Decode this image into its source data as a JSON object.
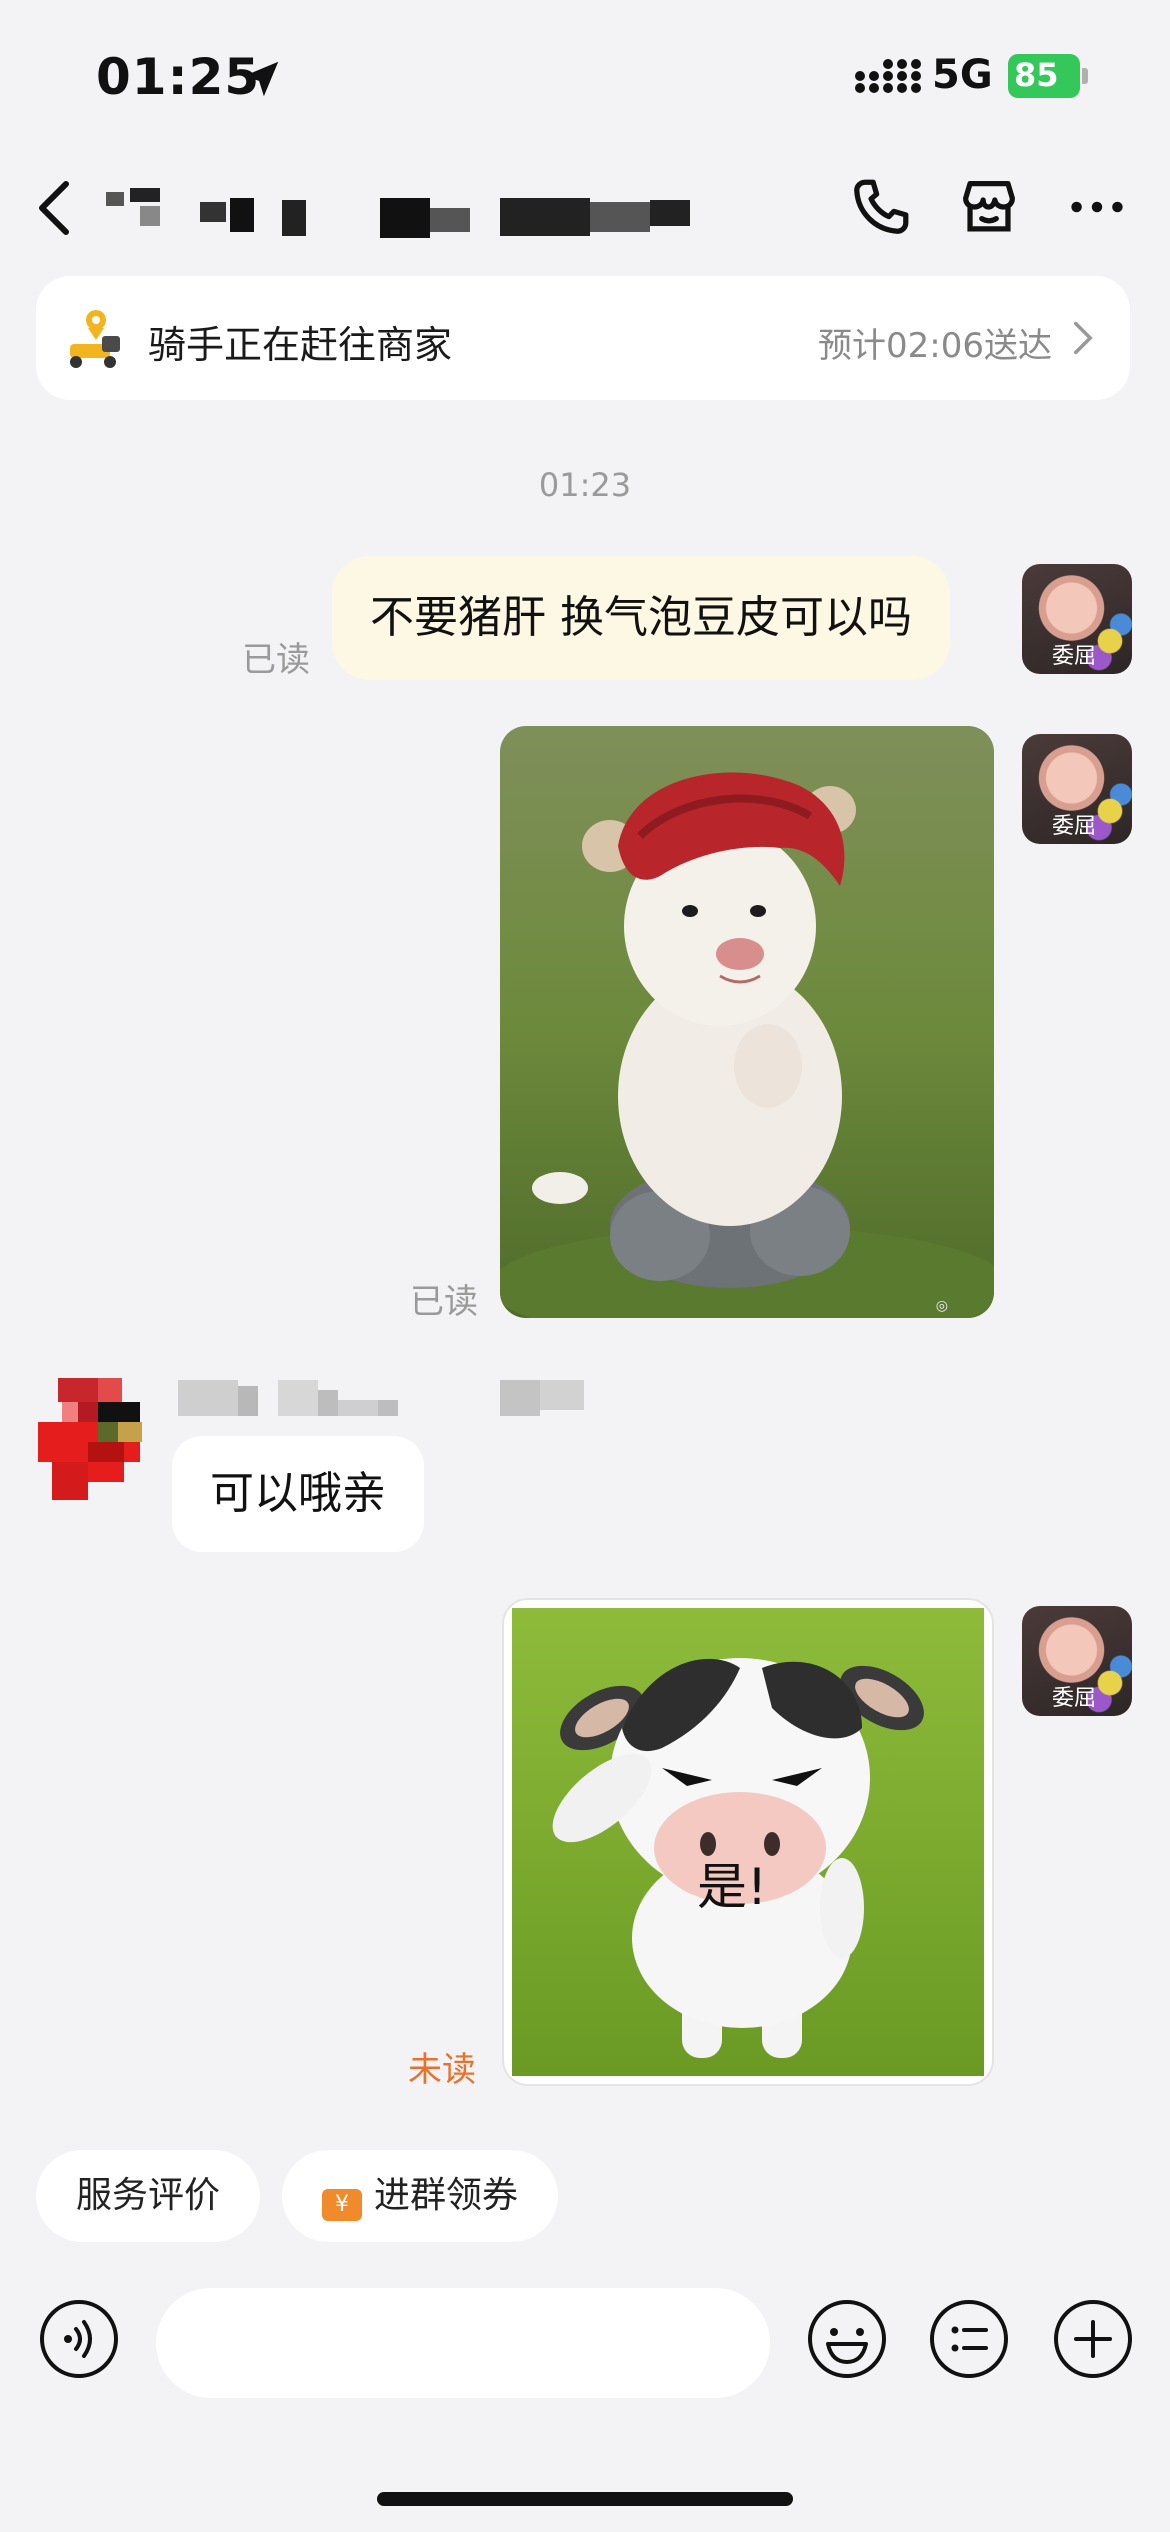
{
  "status_bar": {
    "time": "01:25",
    "network": "5G",
    "battery": "85"
  },
  "nav": {
    "back_icon": "chevron-left-icon",
    "title_blurred": true,
    "icons": [
      "phone-icon",
      "store-icon",
      "more-icon"
    ]
  },
  "delivery": {
    "status": "骑手正在赶往商家",
    "eta": "预计02:06送达"
  },
  "messages": {
    "timestamp": "01:23",
    "m1": {
      "text": "不要猪肝 换气泡豆皮可以吗",
      "receipt": "已读"
    },
    "m2": {
      "receipt": "已读"
    },
    "m3": {
      "text": "可以哦亲"
    },
    "m4": {
      "sticker_caption": "是!",
      "receipt": "未读"
    },
    "my_avatar_label": "委屈"
  },
  "quick_actions": {
    "rate": "服务评价",
    "join_group": "进群领券",
    "coupon_symbol": "¥"
  },
  "toolbar": {
    "icons": [
      "voice-icon",
      "emoji-icon",
      "quick-reply-icon",
      "plus-icon"
    ]
  },
  "colors": {
    "background": "#f3f3f5",
    "outgoing_bubble": "#fdf8e4",
    "unread": "#e7722d",
    "battery": "#34c759"
  }
}
